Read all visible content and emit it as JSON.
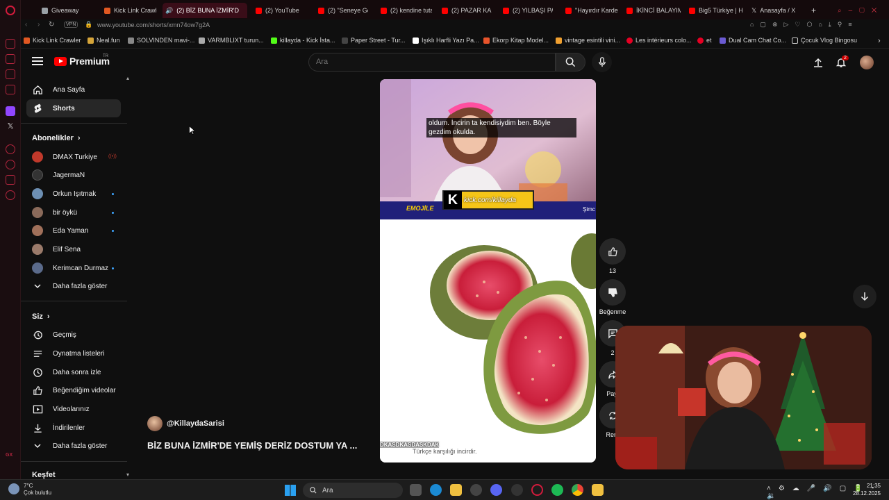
{
  "browser": {
    "tabs": [
      {
        "label": "Giveaway",
        "color": "#9aa0a6"
      },
      {
        "label": "Kick Link Crawle",
        "color": "#e25822"
      },
      {
        "label": "(2) BİZ BUNA İZMİR'D",
        "color": "#ff0000",
        "active": true
      },
      {
        "label": "(2) YouTube",
        "color": "#ff0000"
      },
      {
        "label": "(2) \"Seneye Gö",
        "color": "#ff0000"
      },
      {
        "label": "(2) kendine tuta",
        "color": "#ff0000"
      },
      {
        "label": "(2) PAZAR KAH",
        "color": "#ff0000"
      },
      {
        "label": "(2) YILBAŞI PA",
        "color": "#ff0000"
      },
      {
        "label": "\"Hayırdır Karde",
        "color": "#ff0000"
      },
      {
        "label": "İKİNCİ BALAYIM",
        "color": "#ff0000"
      },
      {
        "label": "Big5 Türkiye | H",
        "color": "#ff0000"
      },
      {
        "label": "Anasayfa / X",
        "color": "#ffffff"
      }
    ],
    "vpn": "VPN",
    "url": "www.youtube.com/shorts/xmn74ow7g2A",
    "bookmarks": [
      "Kick Link Crawler",
      "Neal.fun",
      "SOLVINDEN mavi-...",
      "VARMBLIXT turun...",
      "killayda - Kick İsta...",
      "Paper Street - Tur...",
      "Işıklı Harfli Yazı Pa...",
      "Ekorp Kitap Model...",
      "vintage esintili vini...",
      "Les intérieurs colo...",
      "et",
      "Dual Cam Chat Co...",
      "Çocuk Vlog Bingosu"
    ]
  },
  "youtube": {
    "logo_text": "Premium",
    "logo_country": "TR",
    "search_placeholder": "Ara",
    "notification_count": "2",
    "sidebar": {
      "main": [
        {
          "label": "Ana Sayfa",
          "icon": "home-icon"
        },
        {
          "label": "Shorts",
          "icon": "shorts-icon",
          "active": true
        }
      ],
      "subscriptions_title": "Abonelikler",
      "subscriptions": [
        {
          "label": "DMAX Turkiye",
          "color": "#c0392b",
          "live": true
        },
        {
          "label": "JagermaN",
          "color": "#333333"
        },
        {
          "label": "Orkun Işıtmak",
          "color": "#6d8fb3",
          "dot": true
        },
        {
          "label": "bir öykü",
          "color": "#8a6a5a",
          "dot": true
        },
        {
          "label": "Eda Yaman",
          "color": "#a0705a",
          "dot": true
        },
        {
          "label": "Elif Sena",
          "color": "#9a7a6a"
        },
        {
          "label": "Kerimcan Durmaz",
          "color": "#5a6a8a",
          "dot": true
        }
      ],
      "show_more": "Daha fazla göster",
      "you_title": "Siz",
      "you": [
        {
          "label": "Geçmiş",
          "icon": "history-icon"
        },
        {
          "label": "Oynatma listeleri",
          "icon": "playlists-icon"
        },
        {
          "label": "Daha sonra izle",
          "icon": "watch-later-icon"
        },
        {
          "label": "Beğendiğim videolar",
          "icon": "liked-icon"
        },
        {
          "label": "Videolarınız",
          "icon": "your-videos-icon"
        },
        {
          "label": "İndirilenler",
          "icon": "downloads-icon"
        }
      ],
      "show_more_2": "Daha fazla göster",
      "explore_title": "Keşfet"
    },
    "short": {
      "subtitle_top": "oldum. İncirin ta kendisiydim ben. Böyle gezdim okulda.",
      "kick_url": "kick.com/killayda",
      "emojile": "EMOJİLE",
      "simc": "Şimc",
      "ticker": "DKASDKASDASKDAK",
      "subtitle_bottom": "Türkçe karşılığı incirdir.",
      "channel": "@KillaydaSarisi",
      "title": "BİZ BUNA İZMİR'DE YEMİŞ DERİZ DOSTUM YA ..."
    },
    "actions": {
      "like_count": "13",
      "dislike_label": "Beğenme",
      "comment_count": "2",
      "share_label": "Payl",
      "remix_label": "Rem"
    }
  },
  "taskbar": {
    "temp": "7°C",
    "weather": "Çok bulutlu",
    "search": "Ara",
    "time": "21:35",
    "date": "28.12.2025"
  }
}
